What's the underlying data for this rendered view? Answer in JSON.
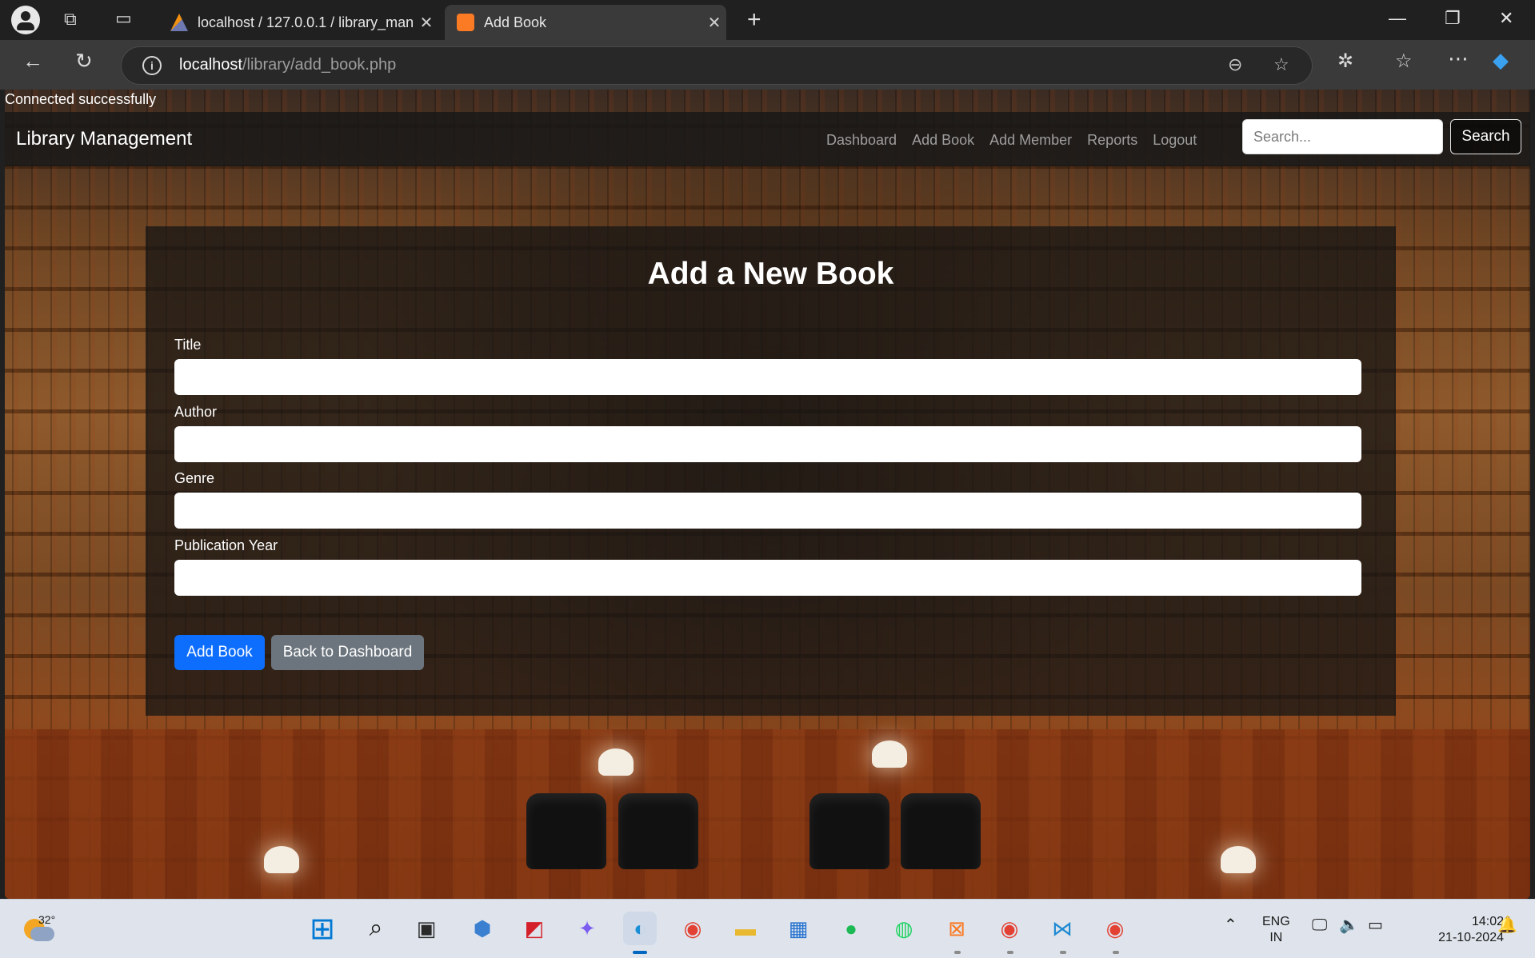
{
  "browser": {
    "tabs": [
      {
        "title": "localhost / 127.0.0.1 / library_man"
      },
      {
        "title": "Add Book",
        "active": true
      }
    ],
    "url_host": "localhost",
    "url_path": "/library/add_book.php"
  },
  "page": {
    "status_text": "Connected successfully",
    "brand": "Library Management",
    "nav": [
      "Dashboard",
      "Add Book",
      "Add Member",
      "Reports",
      "Logout"
    ],
    "search": {
      "placeholder": "Search...",
      "button": "Search"
    },
    "form": {
      "title": "Add a New Book",
      "fields": [
        {
          "label": "Title",
          "value": ""
        },
        {
          "label": "Author",
          "value": ""
        },
        {
          "label": "Genre",
          "value": ""
        },
        {
          "label": "Publication Year",
          "value": ""
        }
      ],
      "submit": "Add Book",
      "back": "Back to Dashboard"
    }
  },
  "taskbar": {
    "weather_temp": "32°",
    "language": "ENG",
    "region": "IN",
    "time": "14:02",
    "date": "21-10-2024",
    "apps": [
      "start",
      "search",
      "task-view",
      "cube",
      "acrobat",
      "copilot",
      "edge",
      "chrome",
      "file-explorer",
      "store",
      "spotify",
      "whatsapp",
      "xampp",
      "chrome-profile",
      "vscode",
      "chrome-2"
    ]
  },
  "colors": {
    "primary_button": "#0d6efd",
    "secondary_button": "#6c757d",
    "navbar_bg": "#181818",
    "taskbar_bg": "#dfe4ec"
  }
}
